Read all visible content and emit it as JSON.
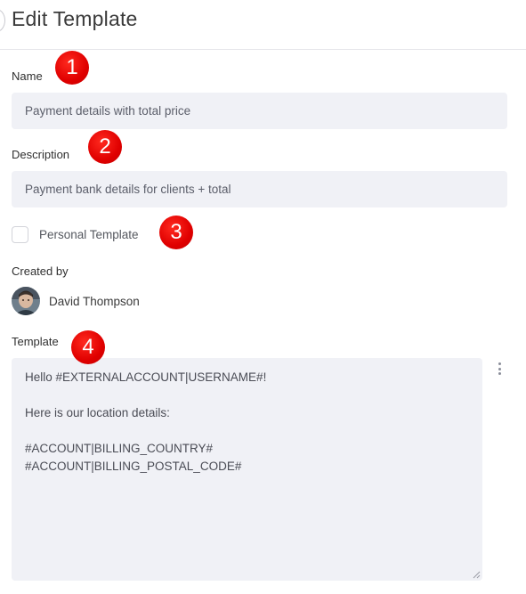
{
  "header": {
    "title": "Edit Template"
  },
  "form": {
    "name_label": "Name",
    "name_value": "Payment details with total price",
    "description_label": "Description",
    "description_value": "Payment bank details for clients + total",
    "personal_template_label": "Personal Template",
    "personal_template_checked": false,
    "created_by_label": "Created by",
    "created_by_user": "David Thompson",
    "template_label": "Template",
    "template_lines": [
      "Hello #EXTERNALACCOUNT|USERNAME#!",
      "",
      "Here is our location details:",
      "",
      "#ACCOUNT|BILLING_COUNTRY#",
      "#ACCOUNT|BILLING_POSTAL_CODE#"
    ]
  },
  "annotations": [
    "1",
    "2",
    "3",
    "4"
  ],
  "colors": {
    "field_bg": "#f0f1f6",
    "marker_red": "#e00000",
    "text": "#333333"
  },
  "icons": {
    "template_menu": "vertical-ellipsis-icon",
    "resize": "resize-grip-icon",
    "back": "back-icon"
  }
}
